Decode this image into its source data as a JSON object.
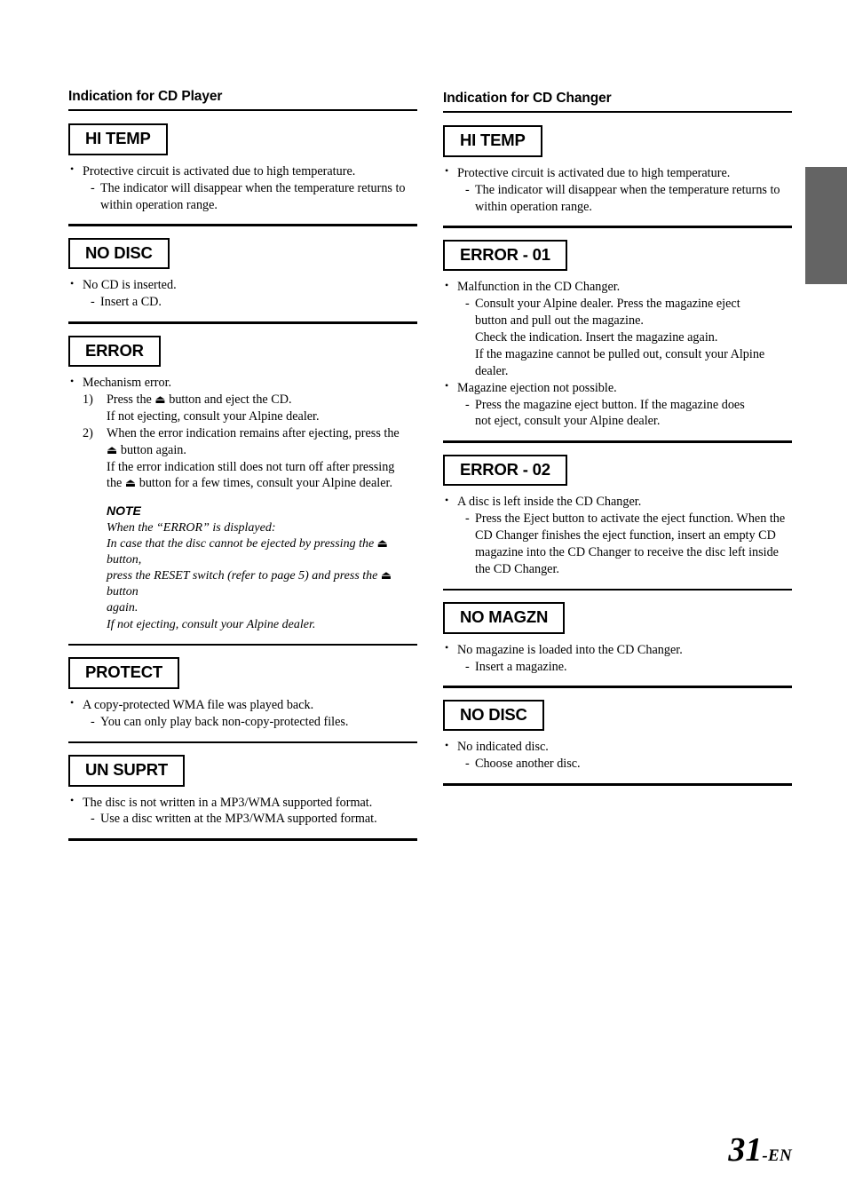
{
  "page": {
    "number": "31",
    "number_suffix": "-EN",
    "edge_tab_color": "#646464"
  },
  "columns": [
    {
      "heading": "Indication for CD Player",
      "sections": [
        {
          "label": "HI TEMP",
          "lines": [
            {
              "kind": "bullet",
              "text": "Protective circuit is activated due to high temperature."
            },
            {
              "kind": "dash",
              "text": "The indicator will disappear when the temperature  returns to"
            },
            {
              "kind": "cont",
              "text": "within operation range."
            }
          ]
        },
        {
          "label": "NO DISC",
          "lines": [
            {
              "kind": "bullet",
              "text": "No CD is inserted."
            },
            {
              "kind": "dash",
              "text": "Insert a CD."
            }
          ]
        },
        {
          "label": "ERROR",
          "lines": [
            {
              "kind": "bullet",
              "text": "Mechanism error."
            },
            {
              "kind": "num",
              "num": "1)",
              "pre": "Press the ",
              "eject": true,
              "post": " button and eject the CD."
            },
            {
              "kind": "numcont",
              "text": "If not ejecting, consult your Alpine dealer."
            },
            {
              "kind": "num",
              "num": "2)",
              "pre": "When the error indication remains after ejecting, press the",
              "eject": false,
              "post": ""
            },
            {
              "kind": "numcont_eject",
              "pre": "",
              "eject": true,
              "post": " button again."
            },
            {
              "kind": "numcont",
              "text": "If the error indication still does not turn off after pressing"
            },
            {
              "kind": "numcont_eject",
              "pre": "the ",
              "eject": true,
              "post": " button for a few times, consult your Alpine dealer."
            }
          ],
          "note": {
            "title": "NOTE",
            "lines": [
              {
                "text": "When the “ERROR” is displayed:"
              },
              {
                "pre": "In case that the disc cannot be ejected by pressing the ",
                "eject": true,
                "post": " button,"
              },
              {
                "pre": "press the RESET switch (refer to page 5) and press the ",
                "eject": true,
                "post": " button"
              },
              {
                "text": "again."
              },
              {
                "text": "If not ejecting, consult your Alpine dealer."
              }
            ]
          }
        },
        {
          "label": "PROTECT",
          "lines": [
            {
              "kind": "bullet",
              "text": "A copy-protected WMA file was played back."
            },
            {
              "kind": "dash",
              "text": "You can only play back non-copy-protected files."
            }
          ]
        },
        {
          "label": "UN SUPRT",
          "lines": [
            {
              "kind": "bullet",
              "text": "The disc is not written in a MP3/WMA supported format."
            },
            {
              "kind": "dash",
              "text": "Use a disc written at the MP3/WMA supported format."
            }
          ]
        }
      ]
    },
    {
      "heading": "Indication for CD Changer",
      "sections": [
        {
          "label": "HI TEMP",
          "lines": [
            {
              "kind": "bullet",
              "text": "Protective circuit is activated due to high temperature."
            },
            {
              "kind": "dash",
              "text": "The indicator will disappear when the temperature  returns to"
            },
            {
              "kind": "cont",
              "text": "within operation range."
            }
          ]
        },
        {
          "label": "ERROR - 01",
          "lines": [
            {
              "kind": "bullet",
              "text": "Malfunction in the CD Changer."
            },
            {
              "kind": "dash",
              "text": "Consult your Alpine dealer. Press the magazine eject"
            },
            {
              "kind": "cont",
              "text": "button and pull out the magazine."
            },
            {
              "kind": "cont",
              "text": "Check the indication. Insert the magazine again."
            },
            {
              "kind": "cont",
              "text": "If the magazine cannot be pulled out, consult your  Alpine"
            },
            {
              "kind": "cont",
              "text": "dealer."
            },
            {
              "kind": "bullet",
              "text": "Magazine ejection not possible."
            },
            {
              "kind": "dash",
              "text": "Press the magazine eject button. If the magazine does"
            },
            {
              "kind": "cont",
              "text": "not eject, consult your Alpine dealer."
            }
          ]
        },
        {
          "label": "ERROR - 02",
          "lines": [
            {
              "kind": "bullet",
              "text": "A disc is left inside the CD Changer."
            },
            {
              "kind": "dash",
              "text": "Press the Eject button to activate the eject function. When the"
            },
            {
              "kind": "cont",
              "text": "CD Changer finishes the eject function, insert an empty CD"
            },
            {
              "kind": "cont",
              "text": "magazine into the CD Changer to receive the disc left inside"
            },
            {
              "kind": "cont",
              "text": "the CD Changer."
            }
          ]
        },
        {
          "label": "NO MAGZN",
          "lines": [
            {
              "kind": "bullet",
              "text": "No magazine is loaded into the CD Changer."
            },
            {
              "kind": "dash",
              "text": "Insert a magazine."
            }
          ]
        },
        {
          "label": "NO DISC",
          "lines": [
            {
              "kind": "bullet",
              "text": "No indicated disc."
            },
            {
              "kind": "dash",
              "text": "Choose another disc."
            }
          ]
        }
      ]
    }
  ],
  "icons": {
    "eject": "⏏"
  }
}
